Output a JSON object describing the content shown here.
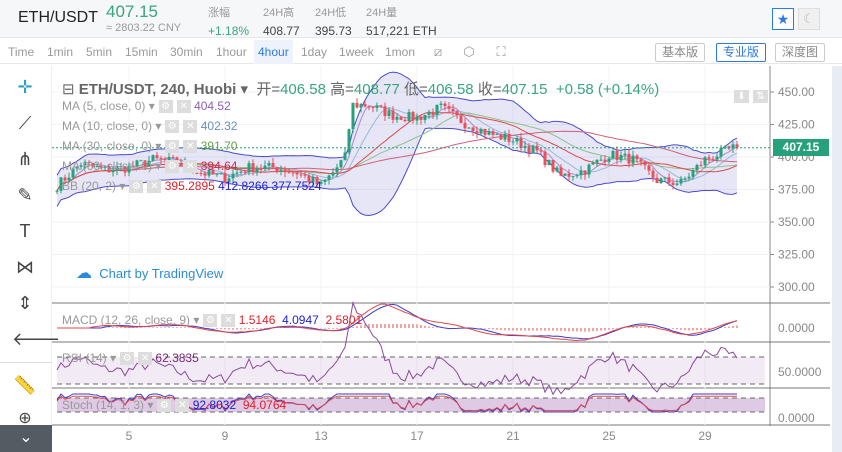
{
  "header": {
    "symbol": "ETH/USDT",
    "last": "407.15",
    "cny": "≈ 2803.22 CNY",
    "stats": [
      {
        "label": "涨幅",
        "value": "+1.18%"
      },
      {
        "label": "24H高",
        "value": "408.77"
      },
      {
        "label": "24H低",
        "value": "395.73"
      },
      {
        "label": "24H量",
        "value": "517,221 ETH"
      }
    ],
    "star_icon": "star-icon",
    "theme_icon": "moon-icon"
  },
  "toolbar": {
    "intervals": [
      "Time",
      "1min",
      "5min",
      "15min",
      "30min",
      "1hour",
      "4hour",
      "1day",
      "1week",
      "1mon"
    ],
    "active": "4hour",
    "icons": [
      "indicator-icon",
      "settings-hex-icon",
      "screenshot-icon"
    ],
    "versions": [
      "基本版",
      "专业版",
      "深度图"
    ],
    "active_version": "专业版"
  },
  "left_tools": [
    "crosshair-icon",
    "trend-line-icon",
    "pitchfork-icon",
    "brush-icon",
    "text-icon",
    "pattern-icon",
    "measure-icon",
    "back-arrow-icon",
    "ruler-icon",
    "zoom-in-icon"
  ],
  "legend": {
    "title": "ETH/USDT, 240, Huobi",
    "o_label": "开=",
    "o": "406.58",
    "h_label": "高=",
    "h": "408.77",
    "l_label": "低=",
    "l": "406.58",
    "c_label": "收=",
    "c": "407.15",
    "change": "+0.58 (+0.14%)",
    "ma5": {
      "label": "MA (5, close, 0)",
      "value": "404.52"
    },
    "ma10": {
      "label": "MA (10, close, 0)",
      "value": "402.32"
    },
    "ma30": {
      "label": "MA (30, close, 0)",
      "value": "391.70"
    },
    "ma60": {
      "label": "MA (60, close, 0)",
      "value": "394.64"
    },
    "bb": {
      "label": "BB (20, 2)",
      "v1": "395.2895",
      "v2": "412.8266",
      "v3": "377.7524"
    },
    "macd": {
      "label": "MACD (12, 26, close, 9)",
      "v1": "1.5146",
      "v2": "4.0947",
      "v3": "2.5801"
    },
    "rsi": {
      "label": "RSI (14)",
      "v1": "62.3835"
    },
    "stoch": {
      "label": "Stoch (14, 1, 3)",
      "v1": "92.8032",
      "v2": "94.0764"
    }
  },
  "watermark": "Chart by TradingView",
  "colors": {
    "up": "#26a17b",
    "down": "#e8505b",
    "accent": "#2c7be5",
    "bb": "#4a4ad0"
  },
  "chart_data": {
    "type": "candlestick",
    "price_axis": [
      "450.00",
      "425.00",
      "400.00",
      "375.00",
      "350.00",
      "325.00",
      "300.00"
    ],
    "ylim": [
      290,
      460
    ],
    "macd_axis": [
      "0.0000"
    ],
    "rsi_axis": [
      "50.0000"
    ],
    "stoch_axis": [
      "0.0000"
    ],
    "x_ticks": [
      "5",
      "9",
      "13",
      "17",
      "21",
      "25",
      "29"
    ],
    "current_price": "407.15",
    "approx_close_by_day": {
      "x": [
        2,
        3,
        4,
        5,
        6,
        7,
        8,
        9,
        10,
        11,
        12,
        13,
        13.5,
        14,
        14.3,
        15,
        16,
        17,
        18,
        19,
        20,
        21,
        22,
        23,
        24,
        25,
        26,
        27,
        28,
        29,
        30.2
      ],
      "y": [
        378,
        395,
        390,
        392,
        398,
        396,
        388,
        384,
        392,
        392,
        388,
        378,
        388,
        400,
        440,
        440,
        432,
        430,
        438,
        426,
        418,
        413,
        404,
        385,
        390,
        402,
        398,
        382,
        380,
        398,
        407
      ]
    }
  }
}
